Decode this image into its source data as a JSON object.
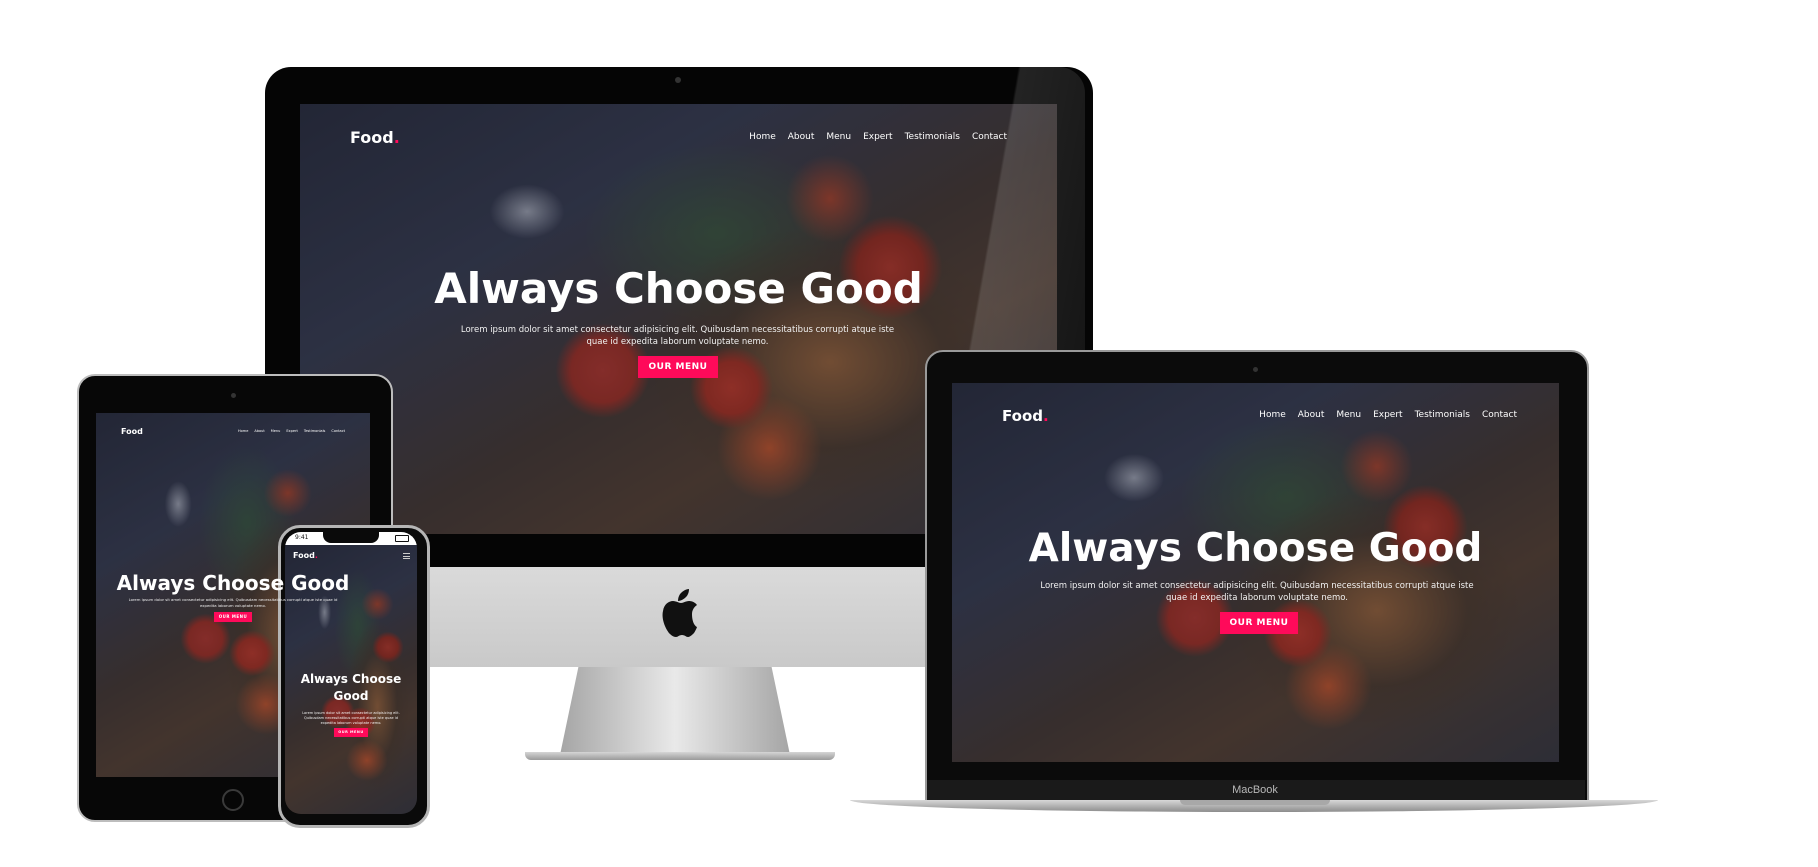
{
  "site": {
    "logo_text": "Food",
    "logo_dot": ".",
    "nav": [
      "Home",
      "About",
      "Menu",
      "Expert",
      "Testimonials",
      "Contact"
    ],
    "hero_title": "Always Choose Good",
    "hero_title_line1": "Always Choose",
    "hero_title_line2": "Good",
    "hero_text": "Lorem ipsum dolor sit amet consectetur adipisicing elit. Quibusdam necessitatibus corrupti atque iste quae id expedita laborum voluptate nemo.",
    "cta_label": "OUR MENU"
  },
  "devices": {
    "macbook_label": "MacBook",
    "iphone_time": "9:41"
  },
  "colors": {
    "accent": "#ff0a5a",
    "device_black": "#050505",
    "aluminum": "#d0d0d0"
  },
  "icons": {
    "apple_logo": "apple-logo-icon",
    "hamburger": "hamburger-menu-icon"
  }
}
